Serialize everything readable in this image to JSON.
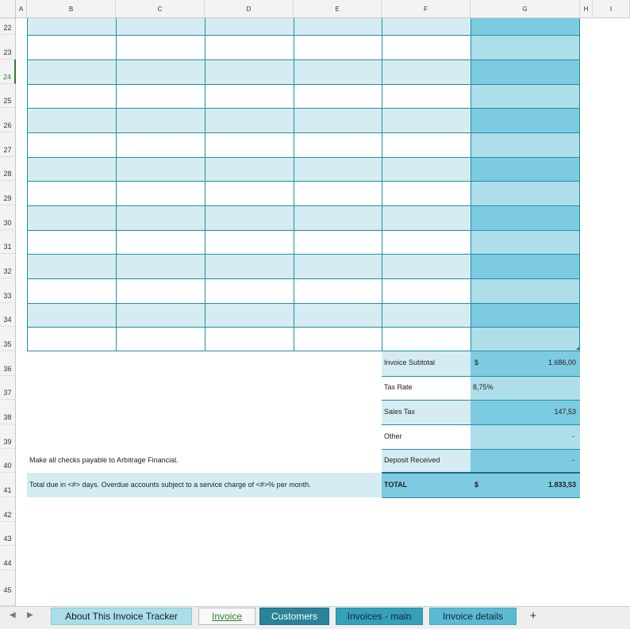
{
  "columns": [
    "A",
    "B",
    "C",
    "D",
    "E",
    "F",
    "G",
    "H",
    "I"
  ],
  "rows": [
    "22",
    "23",
    "24",
    "25",
    "26",
    "27",
    "28",
    "29",
    "30",
    "31",
    "32",
    "33",
    "34",
    "35",
    "36",
    "37",
    "38",
    "39",
    "40",
    "41",
    "42",
    "43",
    "44",
    "45"
  ],
  "summary": {
    "subtotal_label": "Invoice Subtotal",
    "subtotal_currency": "$",
    "subtotal_value": "1.686,00",
    "taxrate_label": "Tax Rate",
    "taxrate_value": "8,75%",
    "salestax_label": "Sales Tax",
    "salestax_value": "147,53",
    "other_label": "Other",
    "other_value": "-",
    "deposit_label": "Deposit Received",
    "deposit_value": "-",
    "total_label": "TOTAL",
    "total_currency": "$",
    "total_value": "1.833,53"
  },
  "notes": {
    "checks_payable": "Make all checks payable to Arbitrage Financial.",
    "terms": "Total due in <#> days. Overdue accounts subject to a service charge of <#>% per month."
  },
  "sheet_tabs": {
    "about": "About This Invoice Tracker",
    "invoice": "Invoice",
    "customers": "Customers",
    "invoices_main": "Invoices - main",
    "invoice_details": "Invoice details",
    "add": "+"
  },
  "nav": {
    "prev": "◀",
    "next": "▶"
  },
  "colors": {
    "band_light": "#d5edf2",
    "total_col_dark": "#7dcbe0",
    "total_col_light": "#addeea",
    "border": "#1f8fa8"
  }
}
